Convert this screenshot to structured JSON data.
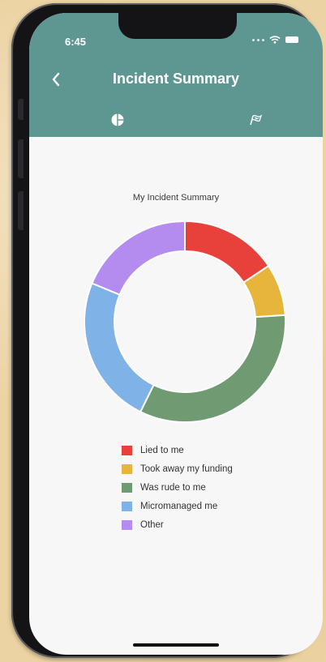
{
  "status_bar": {
    "time": "6:45"
  },
  "app_bar": {
    "title": "Incident Summary",
    "back_icon": "chevron-left-icon",
    "tabs": [
      {
        "icon": "pie-chart-icon",
        "selected": true
      },
      {
        "icon": "flag-icon",
        "selected": false
      }
    ],
    "color": "#5e9791"
  },
  "chart_data": {
    "type": "pie",
    "title": "My Incident Summary",
    "donut": true,
    "legend_position": "bottom",
    "categories": [
      "Lied to me",
      "Took away my funding",
      "Was rude to me",
      "Micromanaged me",
      "Other"
    ],
    "values": [
      15,
      8,
      32,
      23,
      18
    ],
    "colors": [
      "#e8403b",
      "#e8b53c",
      "#6f9a72",
      "#7fb2e6",
      "#b48cf0"
    ]
  }
}
